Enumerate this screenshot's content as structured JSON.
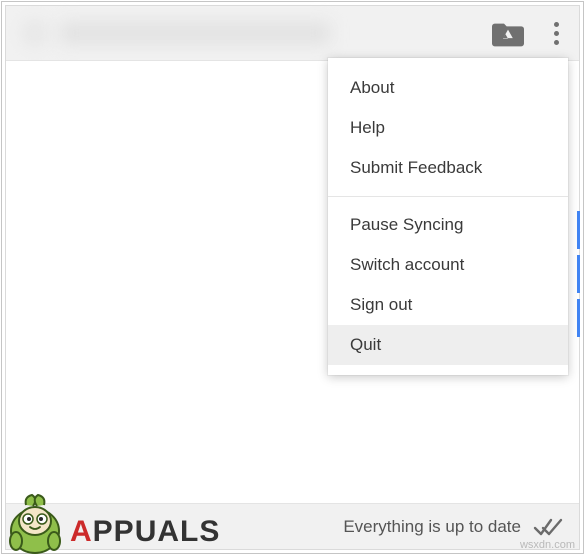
{
  "header": {
    "icons": {
      "drive_folder": "drive-folder-icon",
      "more_menu": "more-vert-icon"
    }
  },
  "menu": {
    "group1": [
      {
        "label": "About"
      },
      {
        "label": "Help"
      },
      {
        "label": "Submit Feedback"
      }
    ],
    "group2": [
      {
        "label": "Pause Syncing"
      },
      {
        "label": "Switch account"
      },
      {
        "label": "Sign out"
      },
      {
        "label": "Quit",
        "hovered": true
      }
    ]
  },
  "status": {
    "text": "Everything is up to date"
  },
  "watermark": {
    "logo_prefix": "A",
    "logo_rest": "PPUALS",
    "source": "wsxdn.com"
  }
}
